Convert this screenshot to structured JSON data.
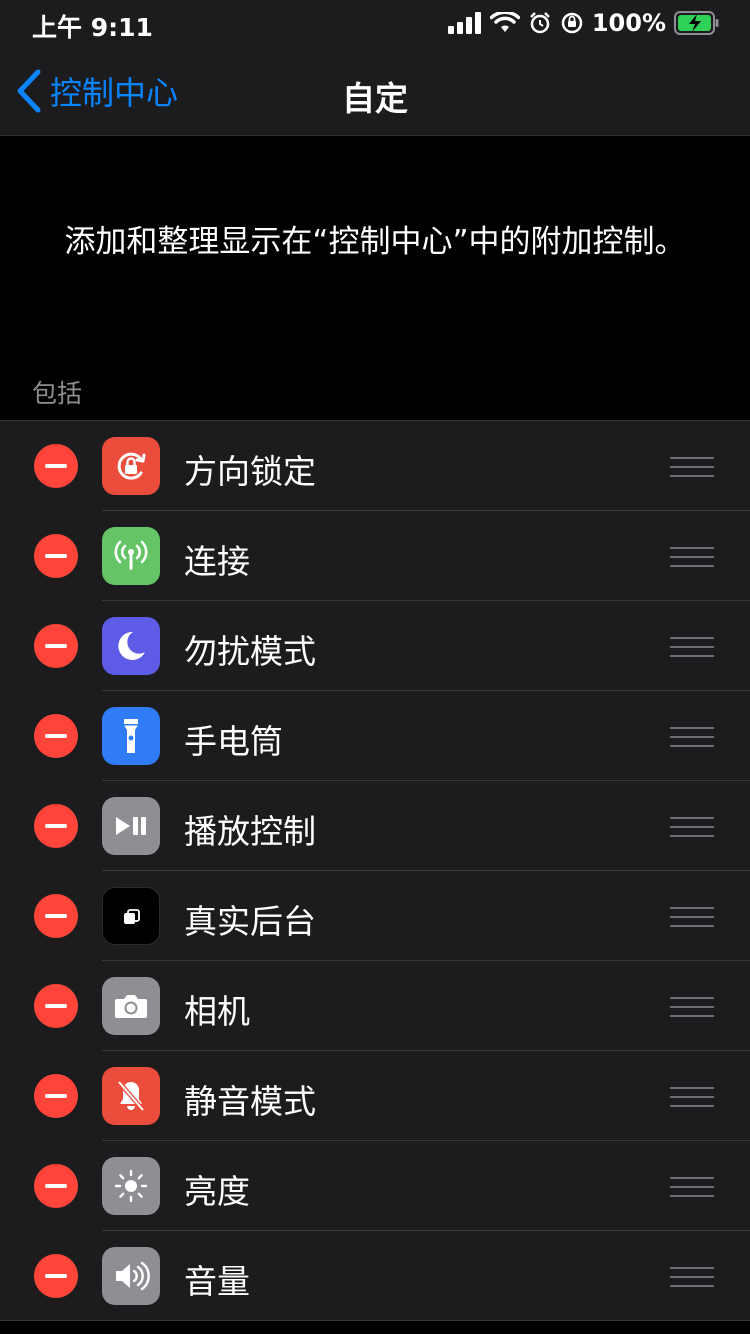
{
  "status_bar": {
    "time": "上午 9:11",
    "battery_percent": "100%"
  },
  "nav": {
    "back_label": "控制中心",
    "title": "自定"
  },
  "description": "添加和整理显示在“控制中心”中的附加控制。",
  "section_header": "包括",
  "colors": {
    "accent": "#0a84ff",
    "remove": "#ff453a",
    "orientation_lock": "#eb4d3d",
    "connectivity": "#65c466",
    "do_not_disturb": "#5e5ce6",
    "flashlight": "#2f7cf6",
    "gray": "#8e8e93",
    "apple_tv": "#000000",
    "mute": "#eb4d3d"
  },
  "included_controls": [
    {
      "label": "方向锁定",
      "icon": "orientation-lock-icon"
    },
    {
      "label": "连接",
      "icon": "antenna-icon"
    },
    {
      "label": "勿扰模式",
      "icon": "moon-icon"
    },
    {
      "label": "手电筒",
      "icon": "flashlight-icon"
    },
    {
      "label": "播放控制",
      "icon": "play-pause-icon"
    },
    {
      "label": "真实后台",
      "icon": "app-switcher-icon"
    },
    {
      "label": "相机",
      "icon": "camera-icon"
    },
    {
      "label": "静音模式",
      "icon": "bell-slash-icon"
    },
    {
      "label": "亮度",
      "icon": "sun-icon"
    },
    {
      "label": "音量",
      "icon": "speaker-icon"
    }
  ]
}
